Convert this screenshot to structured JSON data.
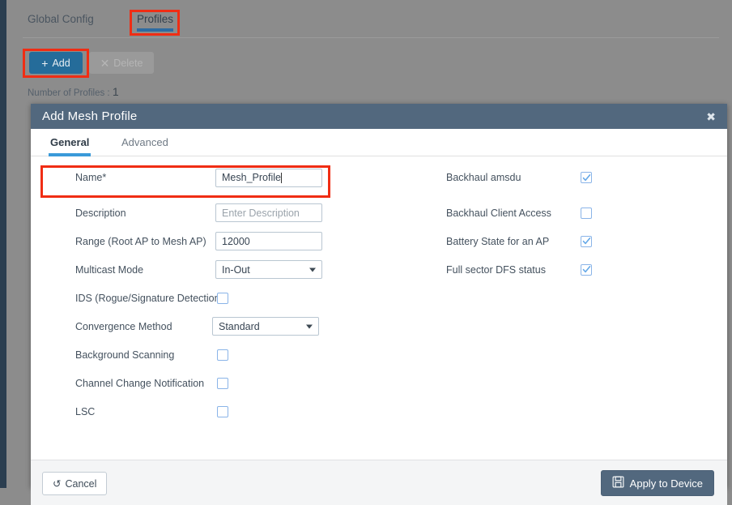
{
  "page": {
    "tabs": [
      {
        "label": "Global Config",
        "active": false
      },
      {
        "label": "Profiles",
        "active": true
      }
    ],
    "toolbar": {
      "add_label": "Add",
      "add_icon": "plus-icon",
      "delete_label": "Delete",
      "delete_icon": "close-x-icon"
    },
    "profile_count_label": "Number of Profiles :",
    "profile_count_value": "1"
  },
  "modal": {
    "title": "Add Mesh Profile",
    "close_icon": "close-icon",
    "tabs": [
      {
        "label": "General",
        "active": true
      },
      {
        "label": "Advanced",
        "active": false
      }
    ],
    "left_fields": [
      {
        "label": "Name*",
        "type": "text",
        "value": "Mesh_Profile",
        "placeholder": "",
        "focused": true
      },
      {
        "label": "Description",
        "type": "text",
        "value": "",
        "placeholder": "Enter Description",
        "focused": false
      },
      {
        "label": "Range (Root AP to Mesh AP)",
        "type": "text",
        "value": "12000",
        "placeholder": "",
        "focused": false
      },
      {
        "label": "Multicast Mode",
        "type": "select",
        "value": "In-Out"
      },
      {
        "label": "IDS (Rogue/Signature Detection)",
        "type": "checkbox",
        "checked": false
      },
      {
        "label": "Convergence Method",
        "type": "select",
        "value": "Standard"
      },
      {
        "label": "Background Scanning",
        "type": "checkbox",
        "checked": false
      },
      {
        "label": "Channel Change Notification",
        "type": "checkbox",
        "checked": false
      },
      {
        "label": "LSC",
        "type": "checkbox",
        "checked": false
      }
    ],
    "right_fields": [
      {
        "label": "Backhaul amsdu",
        "type": "checkbox",
        "checked": true
      },
      {
        "label": "Backhaul Client Access",
        "type": "checkbox",
        "checked": false
      },
      {
        "label": "Battery State for an AP",
        "type": "checkbox",
        "checked": true
      },
      {
        "label": "Full sector DFS status",
        "type": "checkbox",
        "checked": true
      }
    ],
    "footer": {
      "cancel_label": "Cancel",
      "cancel_icon": "undo-icon",
      "apply_label": "Apply to Device",
      "apply_icon": "save-floppy-icon"
    }
  },
  "colors": {
    "accent_blue": "#256c9a",
    "tab_underline": "#2d6ca2",
    "modal_header": "#52687e",
    "highlight_red": "#f02d14",
    "checkbox_blue": "#8ab4e8"
  }
}
